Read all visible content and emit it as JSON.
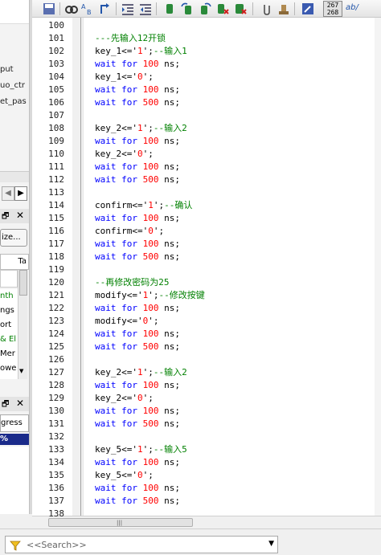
{
  "left_panel": {
    "items": [
      "put",
      "uo_ctr",
      "et_pas"
    ],
    "size_button": "ize...",
    "tab_label": "Ta",
    "list_items": [
      "nth",
      "ngs",
      "ort",
      "& El",
      "Mer",
      "owe"
    ],
    "list_colors": [
      "#008000",
      "#000000",
      "#000000",
      "#008000",
      "#000000",
      "#000000"
    ],
    "progress_label": "gress",
    "progress_value": "%"
  },
  "editor": {
    "lines": [
      {
        "n": "100",
        "t": []
      },
      {
        "n": "101",
        "t": [
          [
            "cm",
            "---先输入12开锁"
          ]
        ]
      },
      {
        "n": "102",
        "t": [
          [
            "",
            "key_1<='"
          ],
          [
            "num",
            "1"
          ],
          [
            "",
            "';"
          ],
          [
            "cm",
            "--输入1"
          ]
        ]
      },
      {
        "n": "103",
        "t": [
          [
            "kw",
            "wait for "
          ],
          [
            "num",
            "100"
          ],
          [
            "",
            " ns;"
          ]
        ]
      },
      {
        "n": "104",
        "t": [
          [
            "",
            "key_1<='"
          ],
          [
            "num",
            "0"
          ],
          [
            "",
            "';"
          ]
        ]
      },
      {
        "n": "105",
        "t": [
          [
            "kw",
            "wait for "
          ],
          [
            "num",
            "100"
          ],
          [
            "",
            " ns;"
          ]
        ]
      },
      {
        "n": "106",
        "t": [
          [
            "kw",
            "wait for "
          ],
          [
            "num",
            "500"
          ],
          [
            "",
            " ns;"
          ]
        ]
      },
      {
        "n": "107",
        "t": []
      },
      {
        "n": "108",
        "t": [
          [
            "",
            "key_2<='"
          ],
          [
            "num",
            "1"
          ],
          [
            "",
            "';"
          ],
          [
            "cm",
            "--输入2"
          ]
        ]
      },
      {
        "n": "109",
        "t": [
          [
            "kw",
            "wait for "
          ],
          [
            "num",
            "100"
          ],
          [
            "",
            " ns;"
          ]
        ]
      },
      {
        "n": "110",
        "t": [
          [
            "",
            "key_2<='"
          ],
          [
            "num",
            "0"
          ],
          [
            "",
            "';"
          ]
        ]
      },
      {
        "n": "111",
        "t": [
          [
            "kw",
            "wait for "
          ],
          [
            "num",
            "100"
          ],
          [
            "",
            " ns;"
          ]
        ]
      },
      {
        "n": "112",
        "t": [
          [
            "kw",
            "wait for "
          ],
          [
            "num",
            "500"
          ],
          [
            "",
            " ns;"
          ]
        ]
      },
      {
        "n": "113",
        "t": []
      },
      {
        "n": "114",
        "t": [
          [
            "",
            "confirm<='"
          ],
          [
            "num",
            "1"
          ],
          [
            "",
            "';"
          ],
          [
            "cm",
            "--确认"
          ]
        ]
      },
      {
        "n": "115",
        "t": [
          [
            "kw",
            "wait for "
          ],
          [
            "num",
            "100"
          ],
          [
            "",
            " ns;"
          ]
        ]
      },
      {
        "n": "116",
        "t": [
          [
            "",
            "confirm<='"
          ],
          [
            "num",
            "0"
          ],
          [
            "",
            "';"
          ]
        ]
      },
      {
        "n": "117",
        "t": [
          [
            "kw",
            "wait for "
          ],
          [
            "num",
            "100"
          ],
          [
            "",
            " ns;"
          ]
        ]
      },
      {
        "n": "118",
        "t": [
          [
            "kw",
            "wait for "
          ],
          [
            "num",
            "500"
          ],
          [
            "",
            " ns;"
          ]
        ]
      },
      {
        "n": "119",
        "t": []
      },
      {
        "n": "120",
        "t": [
          [
            "cm",
            "--再修改密码为25"
          ]
        ]
      },
      {
        "n": "121",
        "t": [
          [
            "",
            "modify<='"
          ],
          [
            "num",
            "1"
          ],
          [
            "",
            "';"
          ],
          [
            "cm",
            "--修改按键"
          ]
        ]
      },
      {
        "n": "122",
        "t": [
          [
            "kw",
            "wait for "
          ],
          [
            "num",
            "100"
          ],
          [
            "",
            " ns;"
          ]
        ]
      },
      {
        "n": "123",
        "t": [
          [
            "",
            "modify<='"
          ],
          [
            "num",
            "0"
          ],
          [
            "",
            "';"
          ]
        ]
      },
      {
        "n": "124",
        "t": [
          [
            "kw",
            "wait for "
          ],
          [
            "num",
            "100"
          ],
          [
            "",
            " ns;"
          ]
        ]
      },
      {
        "n": "125",
        "t": [
          [
            "kw",
            "wait for "
          ],
          [
            "num",
            "500"
          ],
          [
            "",
            " ns;"
          ]
        ]
      },
      {
        "n": "126",
        "t": []
      },
      {
        "n": "127",
        "t": [
          [
            "",
            "key_2<='"
          ],
          [
            "num",
            "1"
          ],
          [
            "",
            "';"
          ],
          [
            "cm",
            "--输入2"
          ]
        ]
      },
      {
        "n": "128",
        "t": [
          [
            "kw",
            "wait for "
          ],
          [
            "num",
            "100"
          ],
          [
            "",
            " ns;"
          ]
        ]
      },
      {
        "n": "129",
        "t": [
          [
            "",
            "key_2<='"
          ],
          [
            "num",
            "0"
          ],
          [
            "",
            "';"
          ]
        ]
      },
      {
        "n": "130",
        "t": [
          [
            "kw",
            "wait for "
          ],
          [
            "num",
            "100"
          ],
          [
            "",
            " ns;"
          ]
        ]
      },
      {
        "n": "131",
        "t": [
          [
            "kw",
            "wait for "
          ],
          [
            "num",
            "500"
          ],
          [
            "",
            " ns;"
          ]
        ]
      },
      {
        "n": "132",
        "t": []
      },
      {
        "n": "133",
        "t": [
          [
            "",
            "key_5<='"
          ],
          [
            "num",
            "1"
          ],
          [
            "",
            "';"
          ],
          [
            "cm",
            "--输入5"
          ]
        ]
      },
      {
        "n": "134",
        "t": [
          [
            "kw",
            "wait for "
          ],
          [
            "num",
            "100"
          ],
          [
            "",
            " ns;"
          ]
        ]
      },
      {
        "n": "135",
        "t": [
          [
            "",
            "key_5<='"
          ],
          [
            "num",
            "0"
          ],
          [
            "",
            "';"
          ]
        ]
      },
      {
        "n": "136",
        "t": [
          [
            "kw",
            "wait for "
          ],
          [
            "num",
            "100"
          ],
          [
            "",
            " ns;"
          ]
        ]
      },
      {
        "n": "137",
        "t": [
          [
            "kw",
            "wait for "
          ],
          [
            "num",
            "500"
          ],
          [
            "",
            " ns;"
          ]
        ]
      },
      {
        "n": "138",
        "t": []
      }
    ]
  },
  "toolbar": {
    "line_counter_top": "267",
    "line_counter_bottom": "268",
    "find_label": "ab/"
  },
  "search": {
    "placeholder": "<<Search>>"
  },
  "colors": {
    "keyword": "#0000ff",
    "number": "#ff0000",
    "comment": "#008000",
    "progress_fill": "#1a2a8a"
  }
}
